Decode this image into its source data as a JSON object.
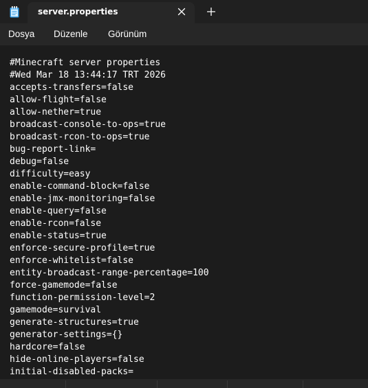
{
  "tab": {
    "title": "server.properties"
  },
  "menu": {
    "file": "Dosya",
    "edit": "Düzenle",
    "view": "Görünüm"
  },
  "content_lines": [
    "#Minecraft server properties",
    "#Wed Mar 18 13:44:17 TRT 2026",
    "accepts-transfers=false",
    "allow-flight=false",
    "allow-nether=true",
    "broadcast-console-to-ops=true",
    "broadcast-rcon-to-ops=true",
    "bug-report-link=",
    "debug=false",
    "difficulty=easy",
    "enable-command-block=false",
    "enable-jmx-monitoring=false",
    "enable-query=false",
    "enable-rcon=false",
    "enable-status=true",
    "enforce-secure-profile=true",
    "enforce-whitelist=false",
    "entity-broadcast-range-percentage=100",
    "force-gamemode=false",
    "function-permission-level=2",
    "gamemode=survival",
    "generate-structures=true",
    "generator-settings={}",
    "hardcore=false",
    "hide-online-players=false",
    "initial-disabled-packs="
  ],
  "icons": {
    "app": "notepad-icon",
    "close": "close-icon",
    "new_tab": "plus-icon"
  },
  "colors": {
    "titlebar": "#202020",
    "chrome": "#272727",
    "editor": "#1c1c1c",
    "text": "#ffffff",
    "icon_accent": "#3aa0e8"
  }
}
